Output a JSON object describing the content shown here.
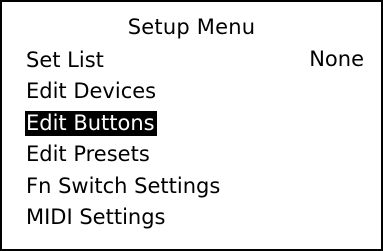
{
  "title": "Setup Menu",
  "menu": {
    "selected_index": 2,
    "items": [
      {
        "label": "Set List",
        "value": "None"
      },
      {
        "label": "Edit Devices"
      },
      {
        "label": "Edit Buttons"
      },
      {
        "label": "Edit Presets"
      },
      {
        "label": "Fn Switch Settings"
      },
      {
        "label": "MIDI Settings"
      }
    ]
  },
  "colors": {
    "background": "#ffffff",
    "foreground": "#000000",
    "highlight_background": "#000000",
    "highlight_text": "#ffffff"
  }
}
